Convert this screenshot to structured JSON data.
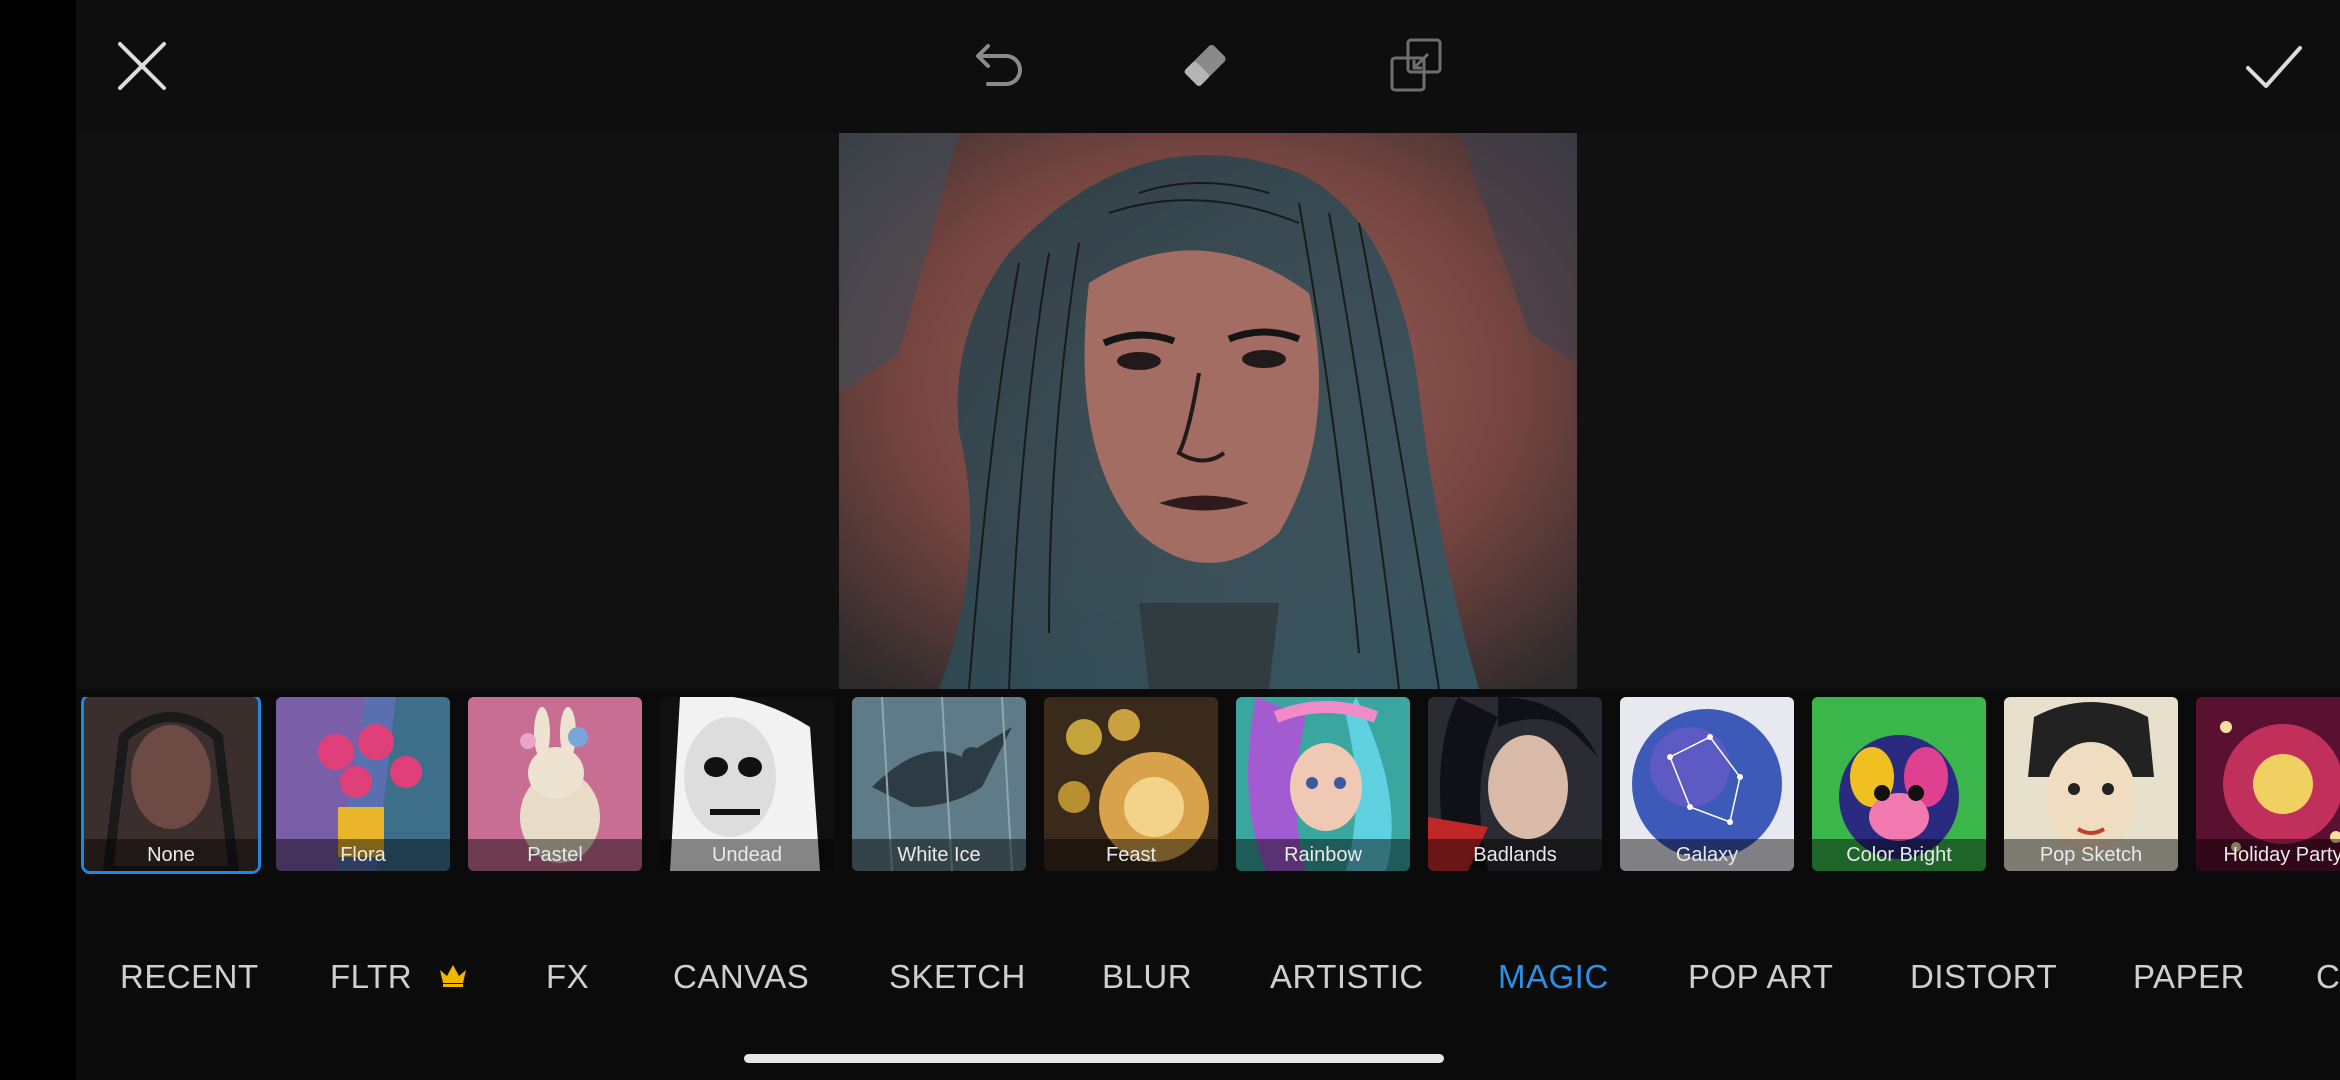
{
  "toolbar": {
    "close_icon": "close-icon",
    "undo_icon": "undo-icon",
    "eraser_icon": "eraser-icon",
    "compare_icon": "compare-icon",
    "apply_icon": "check-icon"
  },
  "effects": [
    {
      "label": "None",
      "selected": true
    },
    {
      "label": "Flora"
    },
    {
      "label": "Pastel"
    },
    {
      "label": "Undead"
    },
    {
      "label": "White Ice"
    },
    {
      "label": "Feast"
    },
    {
      "label": "Rainbow"
    },
    {
      "label": "Badlands"
    },
    {
      "label": "Galaxy"
    },
    {
      "label": "Color Bright"
    },
    {
      "label": "Pop Sketch"
    },
    {
      "label": "Holiday Party"
    }
  ],
  "categories": [
    {
      "label": "RECENT"
    },
    {
      "label": "FLTR",
      "premium": true
    },
    {
      "label": "FX"
    },
    {
      "label": "CANVAS"
    },
    {
      "label": "SKETCH"
    },
    {
      "label": "BLUR"
    },
    {
      "label": "ARTISTIC"
    },
    {
      "label": "MAGIC",
      "active": true
    },
    {
      "label": "POP ART"
    },
    {
      "label": "DISTORT"
    },
    {
      "label": "PAPER"
    },
    {
      "label": "C"
    }
  ],
  "colors": {
    "accent": "#2b8fe6",
    "crown": "#f2b600"
  }
}
